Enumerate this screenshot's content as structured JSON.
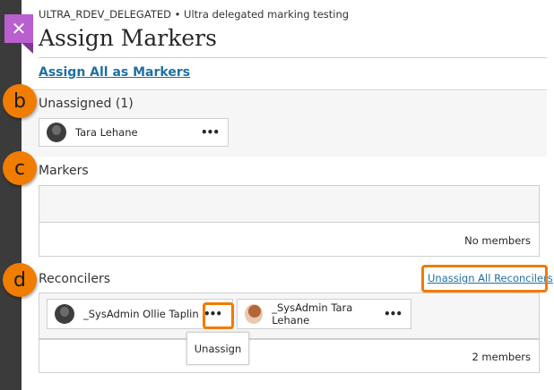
{
  "header": {
    "breadcrumb": "ULTRA_RDEV_DELEGATED • Ultra delegated marking testing",
    "title": "Assign Markers",
    "close_icon": "close-icon"
  },
  "actions": {
    "assign_all": "Assign All as Markers",
    "unassign_all_reconcilers": "Unassign All Reconcilers"
  },
  "unassigned": {
    "label": "Unassigned (1)",
    "members": [
      {
        "name": "Tara Lehane"
      }
    ]
  },
  "markers": {
    "label": "Markers",
    "count_text": "No members"
  },
  "reconcilers": {
    "label": "Reconcilers",
    "members": [
      {
        "name": "_SysAdmin Ollie Taplin"
      },
      {
        "name": "_SysAdmin Tara Lehane"
      }
    ],
    "count_text": "2 members"
  },
  "menu": {
    "unassign": "Unassign"
  },
  "more_glyph": "•••",
  "callouts": [
    "b",
    "c",
    "d"
  ],
  "colors": {
    "accent": "#b95fcf",
    "link": "#1f6fa3",
    "callout": "#f07c00"
  }
}
